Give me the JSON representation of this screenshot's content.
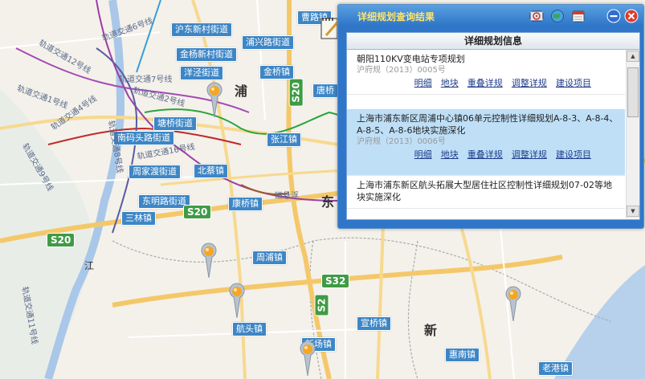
{
  "map": {
    "district_labels": [
      "浦",
      "东",
      "新",
      "江"
    ],
    "area_labels": [
      "沪东新村街道",
      "金杨新村街道",
      "洋泾街道",
      "浦兴路街道",
      "金桥镇",
      "唐桥",
      "塘桥街道",
      "南码头路街道",
      "周家渡街道",
      "东明路街道",
      "三林镇",
      "北蔡镇",
      "康桥镇",
      "张江镇",
      "周浦镇",
      "航头镇",
      "宣桥镇",
      "惠南镇",
      "老港镇",
      "曹路镇",
      "新场镇"
    ],
    "highway_labels": [
      "S20",
      "S20",
      "S20",
      "S32",
      "S2"
    ],
    "rail_labels": [
      "轨道交通6号线",
      "轨道交通12号线",
      "轨道交通4号线",
      "轨道交通2号线",
      "轨道交通7号线",
      "轨道交通8号线",
      "轨道交通11号线",
      "轨道交通9号线",
      "磁悬浮",
      "轨道交通1号线",
      "轨道交通16号线"
    ],
    "pin_count": 5
  },
  "panel": {
    "title": "详细规划查询结果",
    "header": "详细规划信息",
    "toolbar_icons": [
      "locate-icon",
      "globe-icon",
      "calendar-icon",
      "minimize-icon",
      "close-icon"
    ],
    "items": [
      {
        "title": "朝阳110KV变电站专项规划",
        "doc": "沪府规（2013）0005号",
        "links": [
          "明细",
          "地块",
          "重叠详规",
          "调整详规",
          "建设项目"
        ],
        "selected": false
      },
      {
        "title": "上海市浦东新区周浦中心镇06单元控制性详细规划A-8-3、A-8-4、A-8-5、A-8-6地块实施深化",
        "doc": "沪府规（2013）0006号",
        "links": [
          "明细",
          "地块",
          "重叠详规",
          "调整详规",
          "建设项目"
        ],
        "selected": true
      },
      {
        "title": "上海市浦东新区航头拓展大型居住社区控制性详细规划07-02等地块实施深化",
        "doc": "",
        "links": [],
        "selected": false
      }
    ]
  },
  "colors": {
    "accent": "#2f76c8",
    "title_text": "#ffe46a",
    "selected_row": "#bfdff7",
    "label_bg": "#3d86c6",
    "highway": "#3f9b45"
  }
}
